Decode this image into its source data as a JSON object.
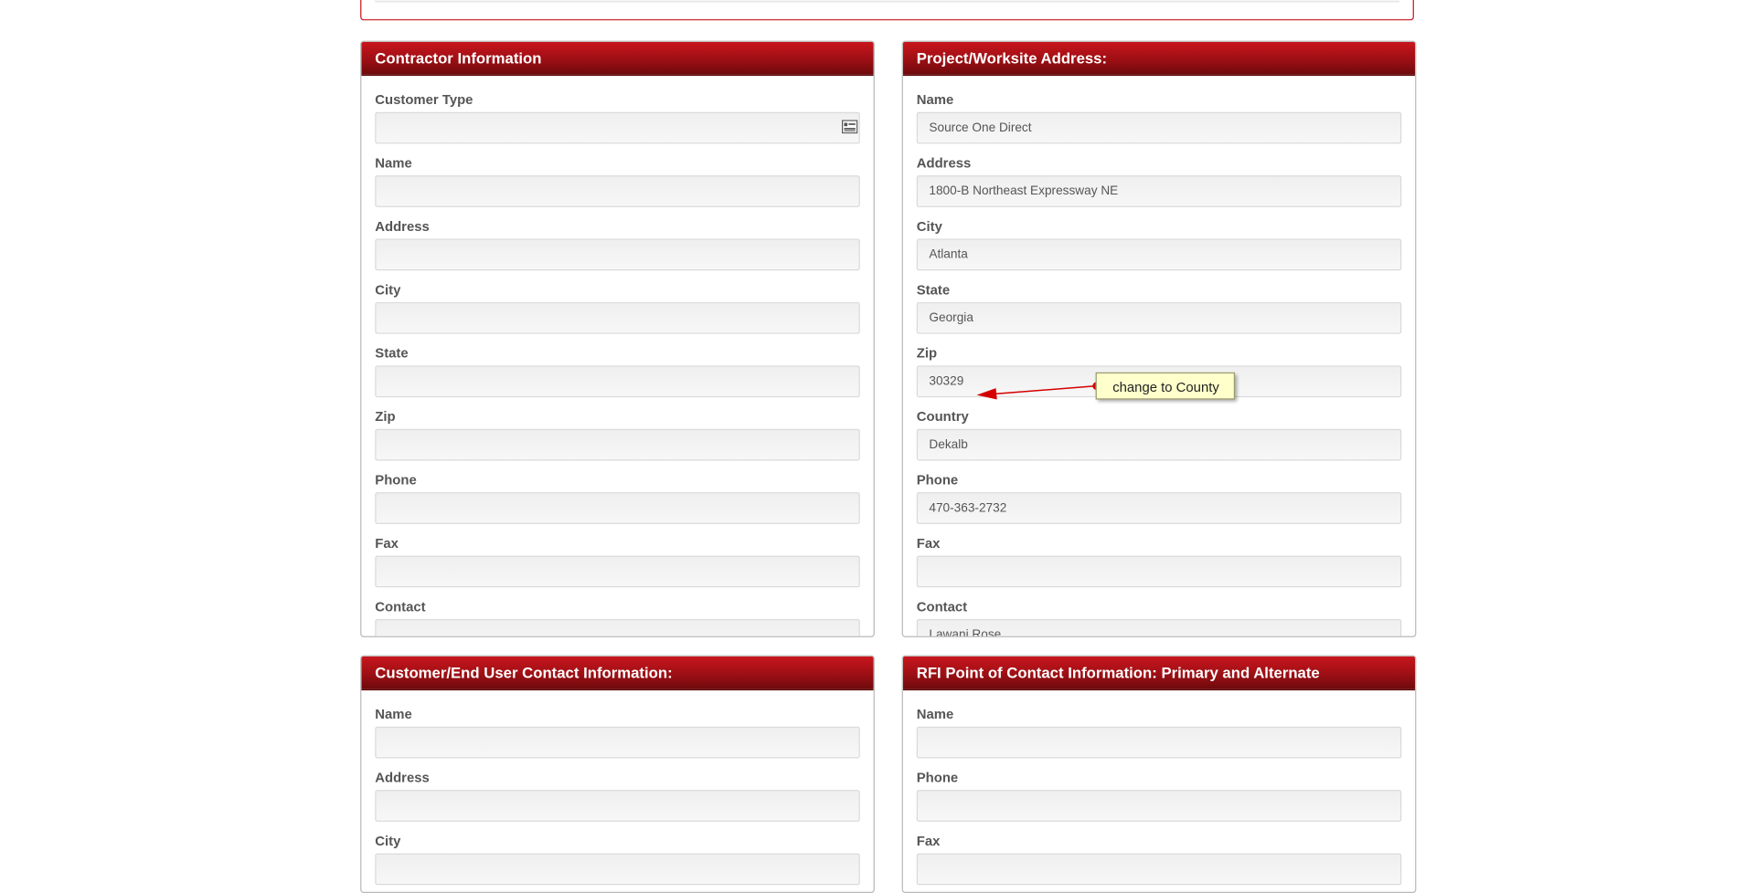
{
  "contractor": {
    "title": "Contractor Information",
    "fields": [
      {
        "label": "Customer Type",
        "value": "",
        "type": "select"
      },
      {
        "label": "Name",
        "value": ""
      },
      {
        "label": "Address",
        "value": ""
      },
      {
        "label": "City",
        "value": ""
      },
      {
        "label": "State",
        "value": ""
      },
      {
        "label": "Zip",
        "value": ""
      },
      {
        "label": "Phone",
        "value": ""
      },
      {
        "label": "Fax",
        "value": ""
      },
      {
        "label": "Contact",
        "value": ""
      }
    ]
  },
  "project": {
    "title": "Project/Worksite Address:",
    "fields": [
      {
        "label": "Name",
        "value": "Source One Direct"
      },
      {
        "label": "Address",
        "value": "1800-B Northeast Expressway NE"
      },
      {
        "label": "City",
        "value": "Atlanta"
      },
      {
        "label": "State",
        "value": "Georgia"
      },
      {
        "label": "Zip",
        "value": "30329"
      },
      {
        "label": "Country",
        "value": "Dekalb"
      },
      {
        "label": "Phone",
        "value": "470-363-2732"
      },
      {
        "label": "Fax",
        "value": ""
      },
      {
        "label": "Contact",
        "value": "Lawani Rose"
      }
    ]
  },
  "customer": {
    "title": "Customer/End User Contact Information:",
    "fields": [
      {
        "label": "Name",
        "value": ""
      },
      {
        "label": "Address",
        "value": ""
      },
      {
        "label": "City",
        "value": ""
      }
    ]
  },
  "rfi": {
    "title": "RFI Point of Contact Information: Primary and Alternate",
    "fields": [
      {
        "label": "Name",
        "value": ""
      },
      {
        "label": "Phone",
        "value": ""
      },
      {
        "label": "Fax",
        "value": ""
      }
    ]
  },
  "annotation": {
    "text": "change to County"
  },
  "colors": {
    "header_red": "#9c0f14",
    "border_red": "#c8171e",
    "callout_bg": "#ffffcc",
    "arrow_red": "#d40000"
  }
}
